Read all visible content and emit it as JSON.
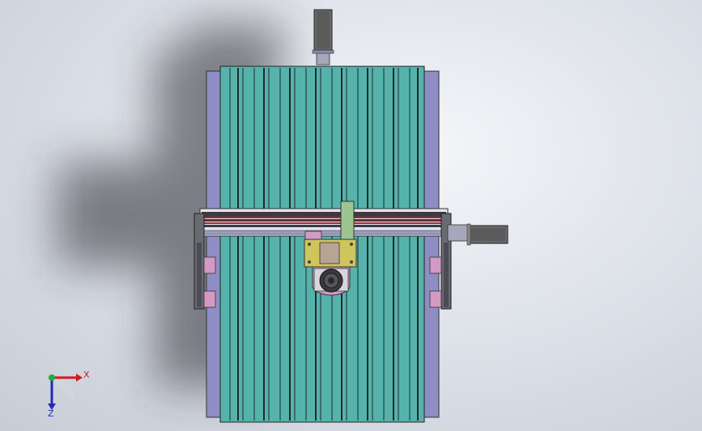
{
  "triad": {
    "x_label": "X",
    "z_label": "Z",
    "x_color": "#d11b1b",
    "y_color": "#1fae3a",
    "z_color": "#1f2bbd"
  },
  "colors": {
    "background": "#dfe3ea",
    "rail_teal": "#55b3ac",
    "rail_purple": "#8e8ec4",
    "rail_cream": "#d8d3a6",
    "gantry_dark": "#3e3a44",
    "gantry_red": "#b52424",
    "carriage_yellow": "#cfc55c",
    "plate_green": "#9cc690",
    "pad_pink": "#d49ac4",
    "motor_gray": "#6a6a6a"
  }
}
